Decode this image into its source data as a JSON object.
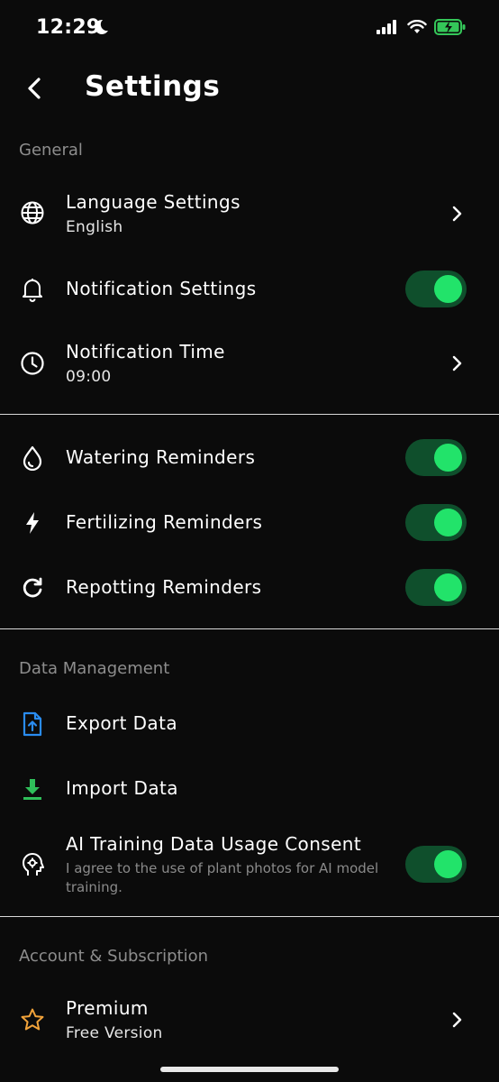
{
  "status_bar": {
    "time": "12:29"
  },
  "nav": {
    "title": "Settings"
  },
  "sections": {
    "general": "General",
    "data_management": "Data Management",
    "account": "Account & Subscription"
  },
  "rows": {
    "language": {
      "title": "Language Settings",
      "value": "English"
    },
    "notification_settings": {
      "title": "Notification Settings",
      "enabled": true
    },
    "notification_time": {
      "title": "Notification Time",
      "value": "09:00"
    },
    "watering": {
      "title": "Watering Reminders",
      "enabled": true
    },
    "fertilizing": {
      "title": "Fertilizing Reminders",
      "enabled": true
    },
    "repotting": {
      "title": "Repotting Reminders",
      "enabled": true
    },
    "export": {
      "title": "Export Data"
    },
    "import": {
      "title": "Import Data"
    },
    "ai_consent": {
      "title": "AI Training Data Usage Consent",
      "description": "I agree to the use of plant photos for AI model training.",
      "enabled": true
    },
    "premium": {
      "title": "Premium",
      "value": "Free Version"
    }
  },
  "colors": {
    "background": "#0b0b0b",
    "toggle_track": "#0f4f2c",
    "toggle_knob": "#22e36a",
    "export_icon": "#2a8cf0",
    "import_icon": "#2fbf5a",
    "premium_icon": "#f2a33a",
    "battery": "#34c759"
  }
}
